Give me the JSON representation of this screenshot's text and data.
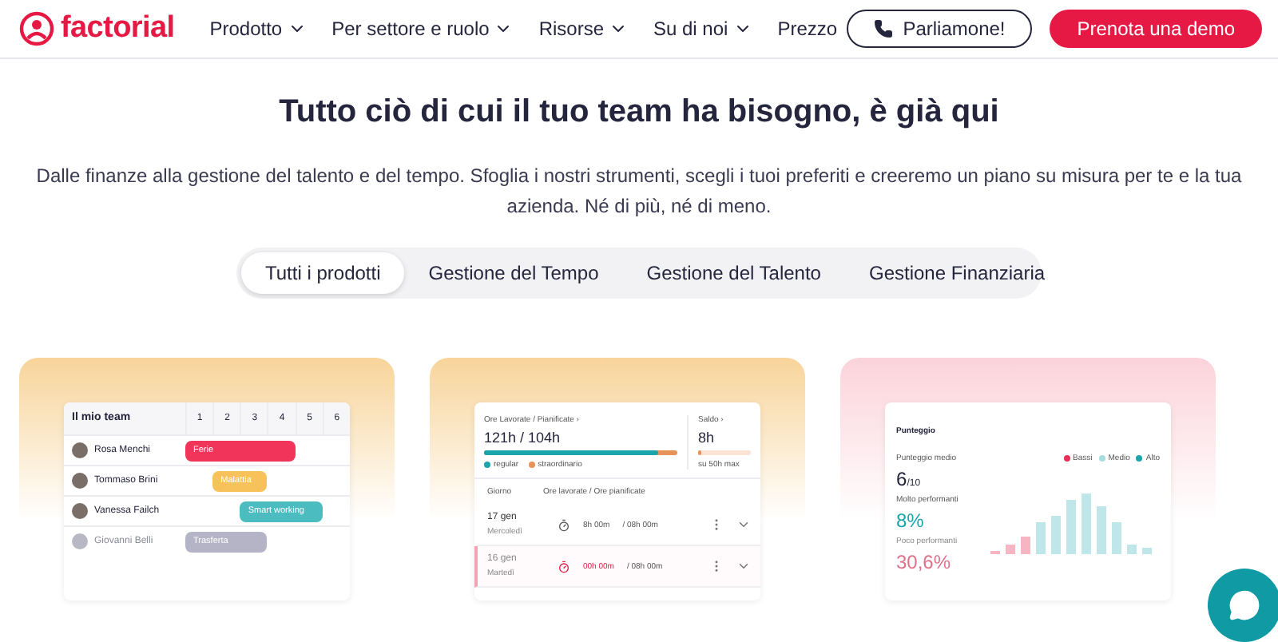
{
  "header": {
    "logo": "factorial",
    "nav": [
      {
        "label": "Prodotto",
        "dropdown": true
      },
      {
        "label": "Per settore e ruolo",
        "dropdown": true
      },
      {
        "label": "Risorse",
        "dropdown": true
      },
      {
        "label": "Su di noi",
        "dropdown": true
      },
      {
        "label": "Prezzo",
        "dropdown": false
      }
    ],
    "call_button": "Parliamone!",
    "demo_button": "Prenota una demo"
  },
  "hero": {
    "title": "Tutto ciò di cui il tuo team ha bisogno, è già qui",
    "text": "Dalle finanze alla gestione del talento e del tempo. Sfoglia i nostri strumenti, scegli i tuoi preferiti e creeremo un piano su misura per te e la tua azienda. Né di più, né di meno."
  },
  "tabs": [
    {
      "label": "Tutti i prodotti",
      "selected": true
    },
    {
      "label": "Gestione del Tempo",
      "selected": false
    },
    {
      "label": "Gestione del Talento",
      "selected": false
    },
    {
      "label": "Gestione Finanziaria",
      "selected": false
    }
  ],
  "cards": [
    {
      "kind": "team",
      "title": "Il mio team",
      "days": [
        "1",
        "2",
        "3",
        "4",
        "5",
        "6"
      ],
      "rows": [
        {
          "name": "Rosa Menchi",
          "dimmed": false,
          "bar": {
            "label": "Ferie",
            "color": "#f0345a"
          }
        },
        {
          "name": "Tommaso Brini",
          "dimmed": false,
          "bar": {
            "label": "Malattia",
            "color": "#f8c25a"
          }
        },
        {
          "name": "Vanessa Failch",
          "dimmed": false,
          "bar": {
            "label": "Smart working",
            "color": "#4bbcc0"
          }
        },
        {
          "name": "Giovanni Belli",
          "dimmed": true,
          "bar": {
            "label": "Trasferta",
            "color": "#b4b4c6"
          }
        }
      ]
    },
    {
      "kind": "hours",
      "worked_label": "Ore Lavorate / Pianificate ›",
      "worked": "121h / 104h",
      "legend": [
        "regular",
        "straordinario"
      ],
      "balance_label": "Saldo ›",
      "balance": "8h",
      "balance_note": "su 50h max",
      "columns": [
        "Giorno",
        "Ore lavorate / Ore pianificate"
      ],
      "rows": [
        {
          "date": "17 gen",
          "day": "Mercoledì",
          "worked": "8h 00m",
          "planned": "/ 08h 00m",
          "dimmed": false
        },
        {
          "date": "16 gen",
          "day": "Martedì",
          "worked": "00h 00m",
          "planned": "/ 08h 00m",
          "dimmed": true
        }
      ]
    },
    {
      "kind": "score",
      "title": "Punteggio",
      "avg_label": "Punteggio medio",
      "avg": "6",
      "avg_of": "/10",
      "high_label": "Molto performanti",
      "high": "8%",
      "low_label": "Poco performanti",
      "low": "30,6%",
      "legend": [
        {
          "label": "Bassi",
          "color": "#e8305a"
        },
        {
          "label": "Medio",
          "color": "#a8dde0"
        },
        {
          "label": "Alto",
          "color": "#1aa5ac"
        }
      ]
    }
  ]
}
